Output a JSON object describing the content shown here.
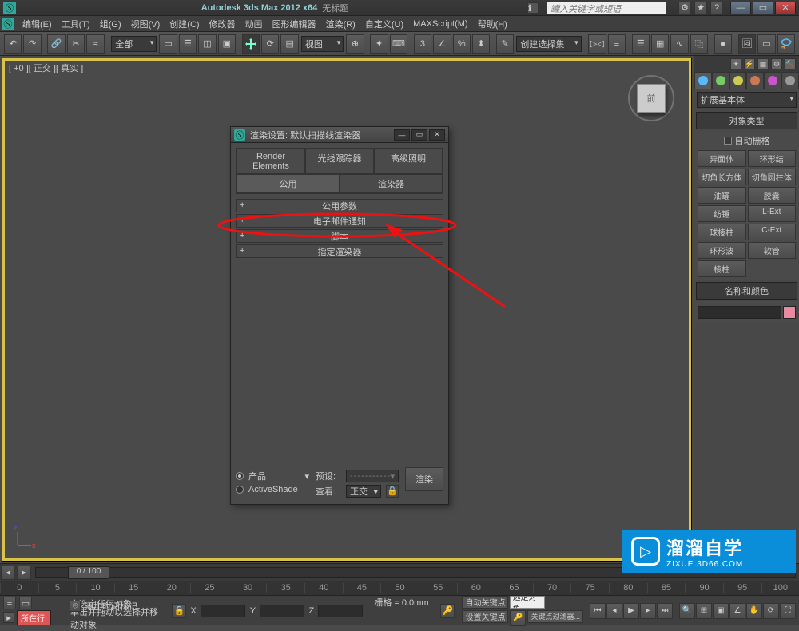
{
  "titlebar": {
    "app_icon_char": "Ⓢ",
    "title": "Autodesk 3ds Max 2012 x64",
    "doc": "无标题",
    "search_placeholder": "罐入关键字或短语",
    "min": "—",
    "max": "▭",
    "close": "✕"
  },
  "menu": [
    "编辑(E)",
    "工具(T)",
    "组(G)",
    "视图(V)",
    "创建(C)",
    "修改器",
    "动画",
    "图形编辑器",
    "渲染(R)",
    "自定义(U)",
    "MAXScript(M)",
    "帮助(H)"
  ],
  "toolbar": {
    "selset_label": "全部",
    "view_label": "视图",
    "named_set": "创建选择集"
  },
  "viewport": {
    "label": "[ +0 ][ 正交 ][ 真实 ]",
    "cube_face": "前"
  },
  "command_panel": {
    "dropdown": "扩展基本体",
    "roll_objtype": "对象类型",
    "autogrid": "自动栅格",
    "buttons": [
      "异面体",
      "环形结",
      "切角长方体",
      "切角圆柱体",
      "油罐",
      "胶囊",
      "纺锤",
      "L-Ext",
      "球棱柱",
      "C-Ext",
      "环形波",
      "软管",
      "棱柱",
      ""
    ],
    "roll_namecolor": "名称和颜色"
  },
  "dialog": {
    "title": "渲染设置: 默认扫描线渲染器",
    "tabs_row1": [
      "Render Elements",
      "光线跟踪器",
      "高级照明"
    ],
    "tabs_row2": [
      "公用",
      "渲染器"
    ],
    "rollouts": [
      "公用参数",
      "电子邮件通知",
      "脚本",
      "指定渲染器"
    ],
    "product": "产品",
    "activeshade": "ActiveShade",
    "preset_label": "预设:",
    "preset_value": "----------------------------",
    "view_label": "查看:",
    "view_value": "正交",
    "render_btn": "渲染"
  },
  "timeline": {
    "thumb": "0 / 100",
    "ticks": [
      "0",
      "5",
      "10",
      "15",
      "20",
      "25",
      "30",
      "35",
      "40",
      "45",
      "50",
      "55",
      "60",
      "65",
      "70",
      "75",
      "80",
      "85",
      "90",
      "95",
      "100"
    ]
  },
  "status": {
    "now_btn": "所在行:",
    "msg1": "未选定任何对象",
    "msg2": "单击并拖动以选择并移动对象",
    "lockicon": "🔒",
    "x": "X:",
    "y": "Y:",
    "z": "Z:",
    "grid": "栅格 = 0.0mm",
    "addtime": "添加时间标记",
    "autokey": "自动关键点",
    "setkey": "设置关键点",
    "selset": "选定对象",
    "keyfilter": "关键点过滤器..."
  },
  "watermark": {
    "big": "溜溜自学",
    "small": "ZIXUE.3D66.COM",
    "play": "▷"
  }
}
